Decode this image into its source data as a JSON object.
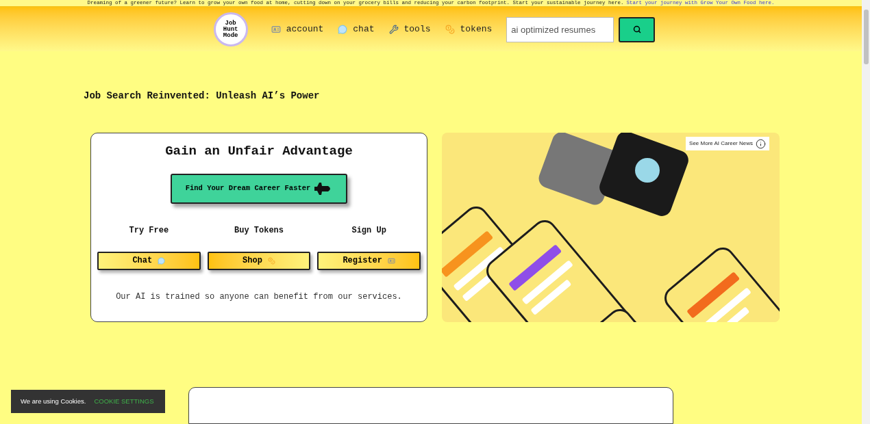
{
  "banner": {
    "text": "Dreaming of a greener future? Learn to grow your own food at home, cutting down on your grocery bills and reducing your carbon footprint. Start your sustainable journey here.",
    "link": "Start your journey with Grow Your Own Food here."
  },
  "header": {
    "logo": [
      "Job",
      "Hunt",
      "Mode"
    ],
    "nav": [
      {
        "label": "account",
        "kind": "id"
      },
      {
        "label": "chat",
        "kind": "chat"
      },
      {
        "label": "tools",
        "kind": "tools"
      },
      {
        "label": "tokens",
        "kind": "coin"
      }
    ],
    "search": {
      "value": "ai optimized resumes"
    }
  },
  "headline": "Job Search Reinvented: Unleash AI’s Power",
  "card": {
    "title": "Gain an Unfair Advantage",
    "cta": "Find Your Dream Career Faster",
    "options": [
      {
        "heading": "Try Free",
        "button": "Chat",
        "kind": "chat"
      },
      {
        "heading": "Buy Tokens",
        "button": "Shop",
        "kind": "coin"
      },
      {
        "heading": "Sign Up",
        "button": "Register",
        "kind": "id"
      }
    ],
    "note": "Our AI is trained so anyone can benefit from our services."
  },
  "promo": {
    "kind": "picture",
    "badge": "See More AI Career News"
  },
  "cookie": {
    "text": "We are using Cookies.",
    "link": "COOKIE SETTINGS"
  }
}
